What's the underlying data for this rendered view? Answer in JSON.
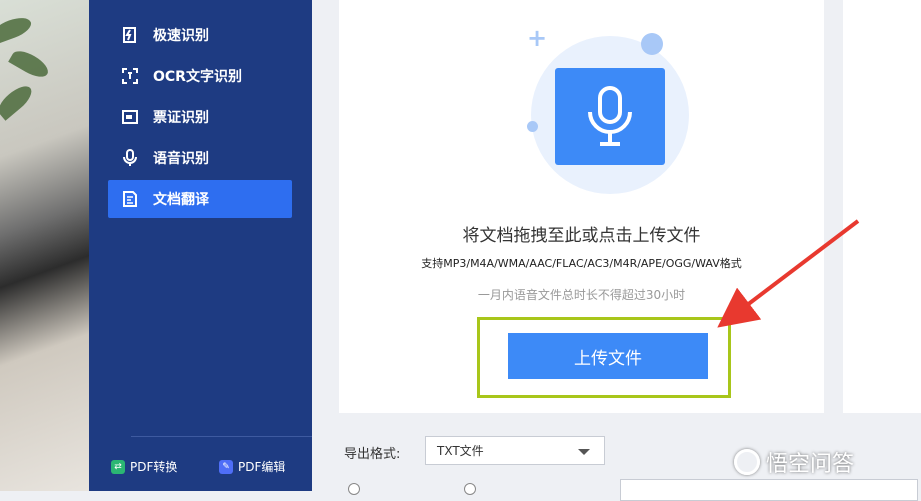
{
  "sidebar": {
    "items": [
      {
        "label": "极速识别",
        "icon": "speed-icon"
      },
      {
        "label": "OCR文字识别",
        "icon": "ocr-scan-icon"
      },
      {
        "label": "票证识别",
        "icon": "ticket-icon"
      },
      {
        "label": "语音识别",
        "icon": "microphone-icon"
      },
      {
        "label": "文档翻译",
        "icon": "document-translate-icon",
        "active": true
      }
    ],
    "bottom_links": [
      {
        "label": "PDF转换",
        "icon": "pdf-convert-icon",
        "color": "#2bb673"
      },
      {
        "label": "PDF编辑",
        "icon": "pdf-edit-icon",
        "color": "#4f6ef7"
      }
    ]
  },
  "upload": {
    "title": "将文档拖拽至此或点击上传文件",
    "formats": "支持MP3/M4A/WMA/AAC/FLAC/AC3/M4R/APE/OGG/WAV格式",
    "limit": "一月内语音文件总时长不得超过30小时",
    "button_label": "上传文件"
  },
  "export": {
    "label": "导出格式:",
    "selected": "TXT文件"
  },
  "watermark": "悟空问答",
  "colors": {
    "sidebar_bg": "#1e3b82",
    "active_item": "#2e6ef0",
    "primary_button": "#3d8af7",
    "highlight_border": "#a8c61a",
    "arrow": "#e8392f"
  }
}
